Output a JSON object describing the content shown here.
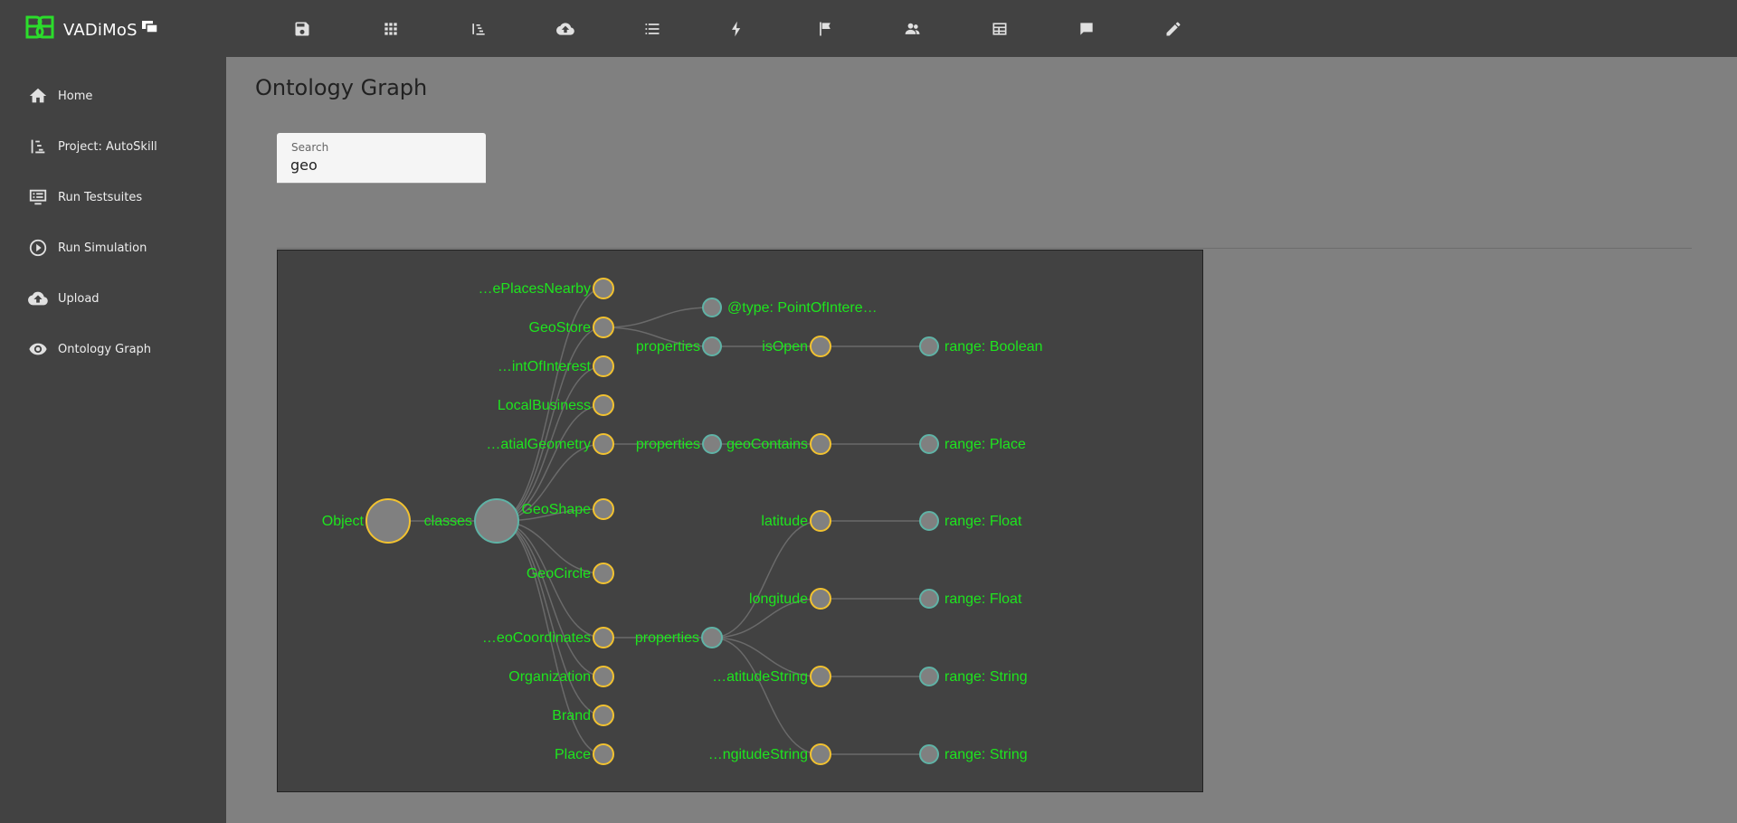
{
  "app": {
    "name": "VADiMoS",
    "colors": {
      "logo": "#2bdd2b",
      "topbar": "#424242",
      "sidebar": "#424242",
      "main_bg": "#808080",
      "graph_bg": "#424242",
      "node_fill": "#808080",
      "node_stroke_yellow": "#f2c230",
      "node_stroke_teal": "#5fb3a6",
      "label_green": "#1ee51e"
    }
  },
  "toolbar": {
    "icons": [
      "save-icon",
      "grid-icon",
      "project-icon",
      "cloud-upload-icon",
      "list-icon",
      "flash-icon",
      "flag-icon",
      "users-icon",
      "table-icon",
      "comment-icon",
      "edit-icon"
    ]
  },
  "sidebar": {
    "items": [
      {
        "label": "Home",
        "icon": "home-icon"
      },
      {
        "label": "Project: AutoSkill",
        "icon": "project-icon"
      },
      {
        "label": "Run Testsuites",
        "icon": "monitor-list-icon"
      },
      {
        "label": "Run Simulation",
        "icon": "play-circle-icon"
      },
      {
        "label": "Upload",
        "icon": "cloud-upload-icon"
      },
      {
        "label": "Ontology Graph",
        "icon": "eye-icon"
      }
    ]
  },
  "main": {
    "title": "Ontology Graph",
    "search": {
      "label": "Search",
      "value": "geo"
    }
  },
  "graph": {
    "nodes": [
      {
        "id": "object",
        "label": "Object",
        "style": "yellow"
      },
      {
        "id": "classes",
        "label": "classes",
        "style": "teal"
      },
      {
        "id": "c0",
        "label": "…ePlacesNearby",
        "style": "yellow"
      },
      {
        "id": "c1",
        "label": "GeoStore",
        "style": "yellow"
      },
      {
        "id": "c2",
        "label": "…intOfInterest",
        "style": "yellow"
      },
      {
        "id": "c3",
        "label": "LocalBusiness",
        "style": "yellow"
      },
      {
        "id": "c4",
        "label": "…atialGeometry",
        "style": "yellow"
      },
      {
        "id": "c5",
        "label": "GeoShape",
        "style": "yellow"
      },
      {
        "id": "c6",
        "label": "GeoCircle",
        "style": "yellow"
      },
      {
        "id": "c7",
        "label": "…eoCoordinates",
        "style": "yellow"
      },
      {
        "id": "c8",
        "label": "Organization",
        "style": "yellow"
      },
      {
        "id": "c9",
        "label": "Brand",
        "style": "yellow"
      },
      {
        "id": "c10",
        "label": "Place",
        "style": "yellow"
      },
      {
        "id": "gs_type",
        "label": "@type: PointOfIntere…",
        "style": "teal"
      },
      {
        "id": "gs_props",
        "label": "properties",
        "style": "teal"
      },
      {
        "id": "isOpen",
        "label": "isOpen",
        "style": "yellow"
      },
      {
        "id": "isOpen_r",
        "label": "range: Boolean",
        "style": "teal"
      },
      {
        "id": "sg_props",
        "label": "properties",
        "style": "teal"
      },
      {
        "id": "geoContains",
        "label": "geoContains",
        "style": "yellow"
      },
      {
        "id": "geoContains_r",
        "label": "range: Place",
        "style": "teal"
      },
      {
        "id": "gc_props",
        "label": "properties",
        "style": "teal"
      },
      {
        "id": "latitude",
        "label": "latitude",
        "style": "yellow"
      },
      {
        "id": "latitude_r",
        "label": "range: Float",
        "style": "teal"
      },
      {
        "id": "longitude",
        "label": "longitude",
        "style": "yellow"
      },
      {
        "id": "longitude_r",
        "label": "range: Float",
        "style": "teal"
      },
      {
        "id": "latStr",
        "label": "…atitudeString",
        "style": "yellow"
      },
      {
        "id": "latStr_r",
        "label": "range: String",
        "style": "teal"
      },
      {
        "id": "lonStr",
        "label": "…ngitudeString",
        "style": "yellow"
      },
      {
        "id": "lonStr_r",
        "label": "range: String",
        "style": "teal"
      }
    ],
    "edges": [
      [
        "object",
        "classes"
      ],
      [
        "classes",
        "c0"
      ],
      [
        "classes",
        "c1"
      ],
      [
        "classes",
        "c2"
      ],
      [
        "classes",
        "c3"
      ],
      [
        "classes",
        "c4"
      ],
      [
        "classes",
        "c5"
      ],
      [
        "classes",
        "c6"
      ],
      [
        "classes",
        "c7"
      ],
      [
        "classes",
        "c8"
      ],
      [
        "classes",
        "c9"
      ],
      [
        "classes",
        "c10"
      ],
      [
        "c1",
        "gs_type"
      ],
      [
        "c1",
        "gs_props"
      ],
      [
        "gs_props",
        "isOpen"
      ],
      [
        "isOpen",
        "isOpen_r"
      ],
      [
        "c4",
        "sg_props"
      ],
      [
        "sg_props",
        "geoContains"
      ],
      [
        "geoContains",
        "geoContains_r"
      ],
      [
        "c7",
        "gc_props"
      ],
      [
        "gc_props",
        "latitude"
      ],
      [
        "gc_props",
        "longitude"
      ],
      [
        "gc_props",
        "latStr"
      ],
      [
        "gc_props",
        "lonStr"
      ],
      [
        "latitude",
        "latitude_r"
      ],
      [
        "longitude",
        "longitude_r"
      ],
      [
        "latStr",
        "latStr_r"
      ],
      [
        "lonStr",
        "lonStr_r"
      ]
    ]
  }
}
